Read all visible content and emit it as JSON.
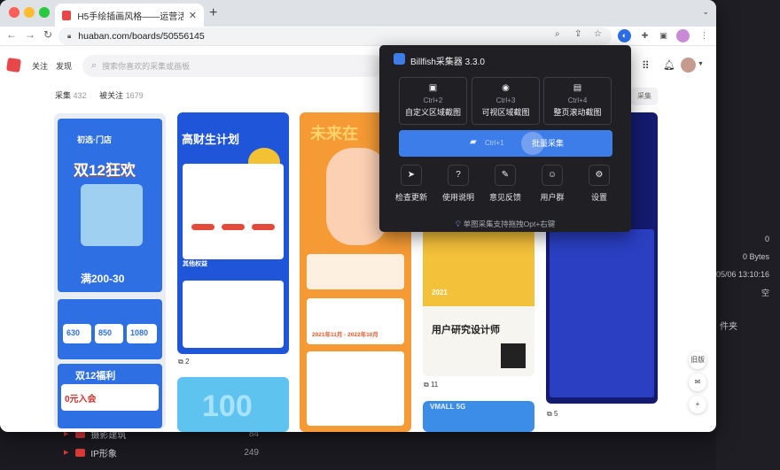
{
  "background_app": {
    "right_values": [
      "0",
      "0 Bytes",
      "05/06 13:10:16",
      "空"
    ],
    "right_button": "件夹",
    "folders": [
      {
        "label": "摄影建筑",
        "count": "84"
      },
      {
        "label": "IP形象",
        "count": "249"
      }
    ]
  },
  "browser": {
    "tab_title": "H5手绘插画风格——运营活动类",
    "url": "huaban.com/boards/50556145"
  },
  "site": {
    "nav": [
      "关注",
      "发现"
    ],
    "search_placeholder": "搜索你喜欢的采集或画板",
    "collect_label": "采集",
    "collect_count": "432",
    "followers_label": "被关注",
    "followers_count": "1679",
    "collect_tag": "采集",
    "side_label": "旧版"
  },
  "cards": {
    "c1": {
      "title": "双12狂欢",
      "brand": "初选·门店",
      "deal": "满200-30",
      "bottom": "双12福利",
      "promo": "0元入会",
      "prices": [
        "630",
        "850",
        "1080"
      ]
    },
    "c2": {
      "title": "高财生计划",
      "sub": "其他权益",
      "caption": "2"
    },
    "c3": {
      "title": "未来在",
      "date": "2021年11月 - 2022年10月",
      "caption": "11"
    },
    "c4": {
      "year": "2021",
      "title": "用户研究设计师",
      "bottom": "VMALL 5G"
    },
    "c5": {
      "caption": "5"
    }
  },
  "popup": {
    "title": "Billfish采集器 3.3.0",
    "captures": [
      {
        "icon": "▣",
        "shortcut": "Ctrl+2",
        "label": "自定义区域截图"
      },
      {
        "icon": "◉",
        "shortcut": "Ctrl+3",
        "label": "可视区域截图"
      },
      {
        "icon": "▤",
        "shortcut": "Ctrl+4",
        "label": "整页滚动截图"
      }
    ],
    "batch": {
      "shortcut": "Ctrl+1",
      "label": "批量采集"
    },
    "actions": [
      {
        "icon": "➤",
        "label": "检查更新"
      },
      {
        "icon": "?",
        "label": "使用说明"
      },
      {
        "icon": "✎",
        "label": "意见反馈"
      },
      {
        "icon": "☺",
        "label": "用户群"
      },
      {
        "icon": "⚙",
        "label": "设置"
      }
    ],
    "tip": "单图采集支持拖拽Opt+右键"
  }
}
